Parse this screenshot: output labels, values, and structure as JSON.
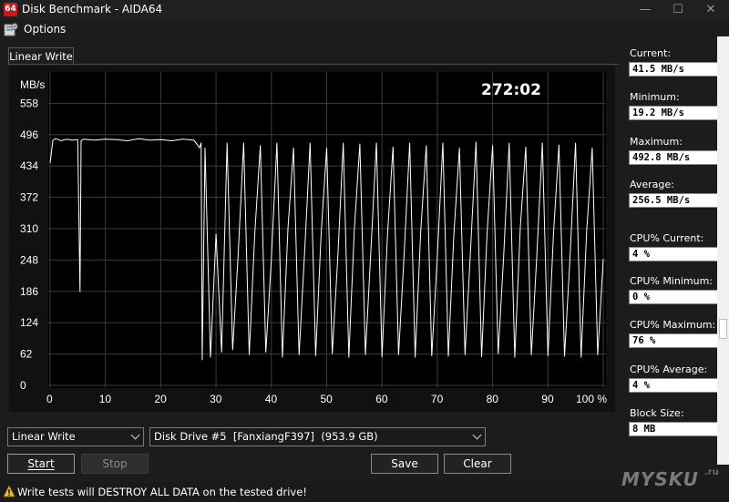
{
  "window": {
    "app_icon": "64",
    "title": "Disk Benchmark - AIDA64",
    "controls": [
      "minimize-icon",
      "maximize-icon",
      "close-icon"
    ]
  },
  "menu": {
    "options_label": "Options",
    "options_icon": "options-icon"
  },
  "tab": {
    "label": "Linear Write"
  },
  "chart": {
    "elapsed": "272:02",
    "y_unit": "MB/s"
  },
  "chart_data": {
    "type": "line",
    "title": "",
    "xlabel": "",
    "ylabel": "MB/s",
    "y_ticks": [
      0,
      62,
      124,
      186,
      248,
      310,
      372,
      434,
      496,
      558
    ],
    "x_ticks": [
      "0",
      "10",
      "20",
      "30",
      "40",
      "50",
      "60",
      "70",
      "80",
      "90",
      "100 %"
    ],
    "xlim": [
      0,
      100
    ],
    "ylim": [
      0,
      620
    ],
    "grid": true,
    "series": [
      {
        "values_description_free": true,
        "x": [
          0,
          0.5,
          1,
          2,
          3,
          4,
          5,
          5.4,
          5.6,
          6,
          8,
          10,
          12,
          14,
          16,
          18,
          20,
          22,
          24,
          26,
          27,
          27.3,
          27.5,
          28,
          29,
          30,
          31,
          32,
          33,
          34,
          35,
          36,
          37,
          38,
          39,
          40,
          41,
          42,
          43,
          44,
          45,
          46,
          47,
          48,
          49,
          50,
          51,
          52,
          53,
          54,
          55,
          56,
          57,
          58,
          59,
          60,
          61,
          62,
          63,
          64,
          65,
          66,
          67,
          68,
          69,
          70,
          71,
          72,
          73,
          74,
          75,
          76,
          77,
          78,
          79,
          80,
          81,
          82,
          83,
          84,
          85,
          86,
          87,
          88,
          89,
          90,
          91,
          92,
          93,
          94,
          95,
          96,
          97,
          98,
          99,
          100
        ],
        "y": [
          440,
          485,
          488,
          484,
          487,
          485,
          486,
          185,
          484,
          487,
          485,
          487,
          486,
          484,
          488,
          485,
          486,
          484,
          487,
          485,
          470,
          480,
          50,
          470,
          55,
          300,
          65,
          480,
          70,
          260,
          480,
          60,
          300,
          475,
          65,
          250,
          480,
          55,
          310,
          470,
          60,
          260,
          480,
          58,
          300,
          470,
          62,
          250,
          480,
          55,
          310,
          478,
          60,
          270,
          480,
          56,
          300,
          472,
          60,
          260,
          480,
          55,
          305,
          475,
          58,
          255,
          480,
          57,
          300,
          470,
          60,
          265,
          482,
          56,
          300,
          475,
          62,
          255,
          480,
          55,
          310,
          472,
          60,
          260,
          480,
          58,
          300,
          476,
          57,
          255,
          480,
          55,
          305,
          470,
          60,
          250
        ]
      }
    ]
  },
  "stats": [
    {
      "label": "Current:",
      "value": "41.5 MB/s"
    },
    {
      "label": "Minimum:",
      "value": "19.2 MB/s"
    },
    {
      "label": "Maximum:",
      "value": "492.8 MB/s"
    },
    {
      "label": "Average:",
      "value": "256.5 MB/s"
    },
    {
      "label": "CPU% Current:",
      "value": "4 %"
    },
    {
      "label": "CPU% Minimum:",
      "value": "0 %"
    },
    {
      "label": "CPU% Maximum:",
      "value": "76 %"
    },
    {
      "label": "CPU% Average:",
      "value": "4 %"
    },
    {
      "label": "Block Size:",
      "value": "8 MB"
    }
  ],
  "controls": {
    "test_select": "Linear Write",
    "drive_select": "Disk Drive #5  [FanxiangF397]  (953.9 GB)",
    "start": "Start",
    "stop": "Stop",
    "save": "Save",
    "clear": "Clear"
  },
  "status": {
    "warning": "Write tests will DESTROY ALL DATA on the tested drive!"
  },
  "watermark": {
    "text": "MYSKU",
    "sup": ".ru"
  },
  "colors": {
    "chart_bg": "#000000",
    "grid": "#3c3c3c",
    "line": "#ffffff",
    "app_icon_red": "#c8171f"
  }
}
